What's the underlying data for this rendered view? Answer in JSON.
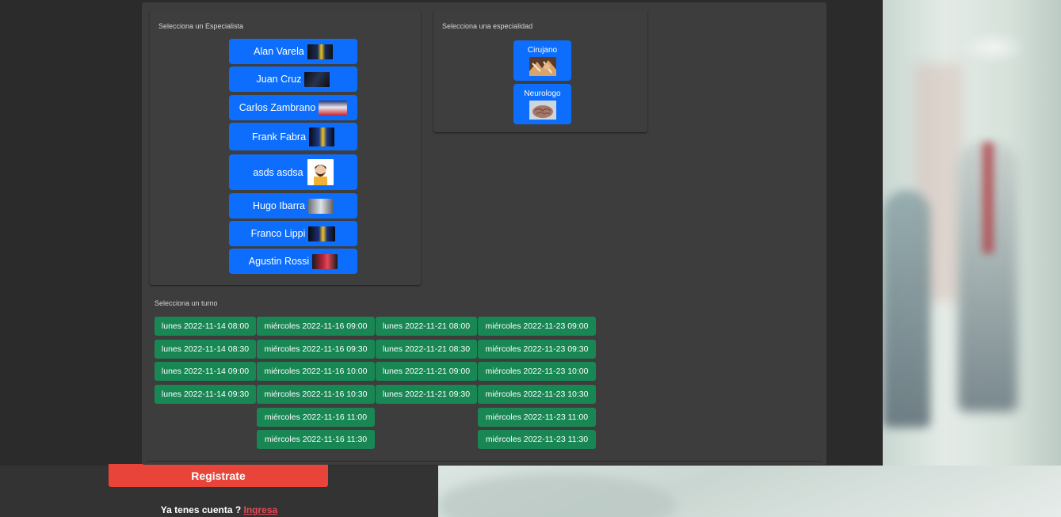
{
  "specialists": {
    "title": "Selecciona un Especialista",
    "items": [
      {
        "name": "Alan Varela",
        "thumb": "player-blue-yellow"
      },
      {
        "name": "Juan Cruz",
        "thumb": "player-dark"
      },
      {
        "name": "Carlos Zambrano",
        "thumb": "player-red-white"
      },
      {
        "name": "Frank Fabra",
        "thumb": "player-blue-yellow"
      },
      {
        "name": "asds asdsa",
        "thumb": "avatar-bearded-man"
      },
      {
        "name": "Hugo Ibarra",
        "thumb": "player-white"
      },
      {
        "name": "Franco Lippi",
        "thumb": "player-blue-yellow"
      },
      {
        "name": "Agustin Rossi",
        "thumb": "player-red"
      }
    ]
  },
  "specialties": {
    "title": "Selecciona una especialidad",
    "items": [
      {
        "label": "Cirujano",
        "icon": "surgery-icon"
      },
      {
        "label": "Neurologo",
        "icon": "brain-icon"
      }
    ]
  },
  "turns": {
    "title": "Selecciona un turno",
    "columns": [
      [
        "lunes 2022-11-14 08:00",
        "lunes 2022-11-14 08:30",
        "lunes 2022-11-14 09:00",
        "lunes 2022-11-14 09:30"
      ],
      [
        "miércoles 2022-11-16 09:00",
        "miércoles 2022-11-16 09:30",
        "miércoles 2022-11-16 10:00",
        "miércoles 2022-11-16 10:30",
        "miércoles 2022-11-16 11:00",
        "miércoles 2022-11-16 11:30"
      ],
      [
        "lunes 2022-11-21 08:00",
        "lunes 2022-11-21 08:30",
        "lunes 2022-11-21 09:00",
        "lunes 2022-11-21 09:30"
      ],
      [
        "miércoles 2022-11-23 09:00",
        "miércoles 2022-11-23 09:30",
        "miércoles 2022-11-23 10:00",
        "miércoles 2022-11-23 10:30",
        "miércoles 2022-11-23 11:00",
        "miércoles 2022-11-23 11:30"
      ]
    ]
  },
  "footer": {
    "register_label": "Registrate",
    "login_prompt": "Ya tenes cuenta ? ",
    "login_link": "Ingresa"
  },
  "colors": {
    "primary": "#0d6efd",
    "success": "#198754",
    "danger": "#e9443a",
    "panel": "#3d3d3d"
  }
}
